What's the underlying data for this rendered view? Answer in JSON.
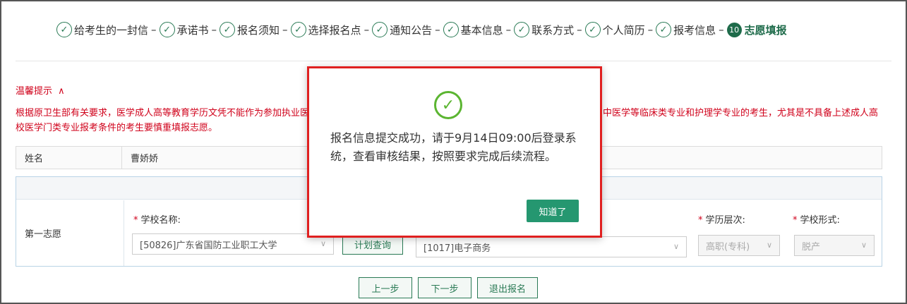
{
  "steps": [
    {
      "label": "给考生的一封信",
      "done": true
    },
    {
      "label": "承诺书",
      "done": true
    },
    {
      "label": "报名须知",
      "done": true
    },
    {
      "label": "选择报名点",
      "done": true
    },
    {
      "label": "通知公告",
      "done": true
    },
    {
      "label": "基本信息",
      "done": true
    },
    {
      "label": "联系方式",
      "done": true
    },
    {
      "label": "个人简历",
      "done": true
    },
    {
      "label": "报考信息",
      "done": true
    },
    {
      "label": "志愿填报",
      "number": "10",
      "active": true
    }
  ],
  "step_separator": "–",
  "tips": {
    "title": "温馨提示",
    "toggle_icon": "chevron-up",
    "text": "根据原卫生部有关要求，医学成人高等教育学历文凭不能作为参加执业医师资格考试的学历依据，报考医学门类临床医学、口腔医学、预防医学、中医学等临床类专业和护理学专业的考生，尤其是不具备上述成人高校医学门类专业报考条件的考生要慎重填报志愿。"
  },
  "name_row": {
    "label": "姓名",
    "value": "曹娇娇"
  },
  "first_choice": {
    "label": "第一志愿",
    "school_label": "学校名称:",
    "school_value": "[50826]广东省国防工业职工大学",
    "plan_button": "计划查询",
    "major_value": "[1017]电子商务",
    "level_label": "学历层次:",
    "level_value": "高职(专科)",
    "form_label": "学校形式:",
    "form_value": "脱产"
  },
  "nav": {
    "prev": "上一步",
    "next": "下一步",
    "exit": "退出报名"
  },
  "modal": {
    "icon": "check-circle",
    "message": "报名信息提交成功，请于9月14日09:00后登录系统，查看审核结果，按照要求完成后续流程。",
    "ok": "知道了"
  },
  "colors": {
    "accent": "#1e6b4a",
    "button": "#259770",
    "warning": "#d0021b",
    "success_icon": "#5bb531",
    "modal_border": "#e02020"
  }
}
